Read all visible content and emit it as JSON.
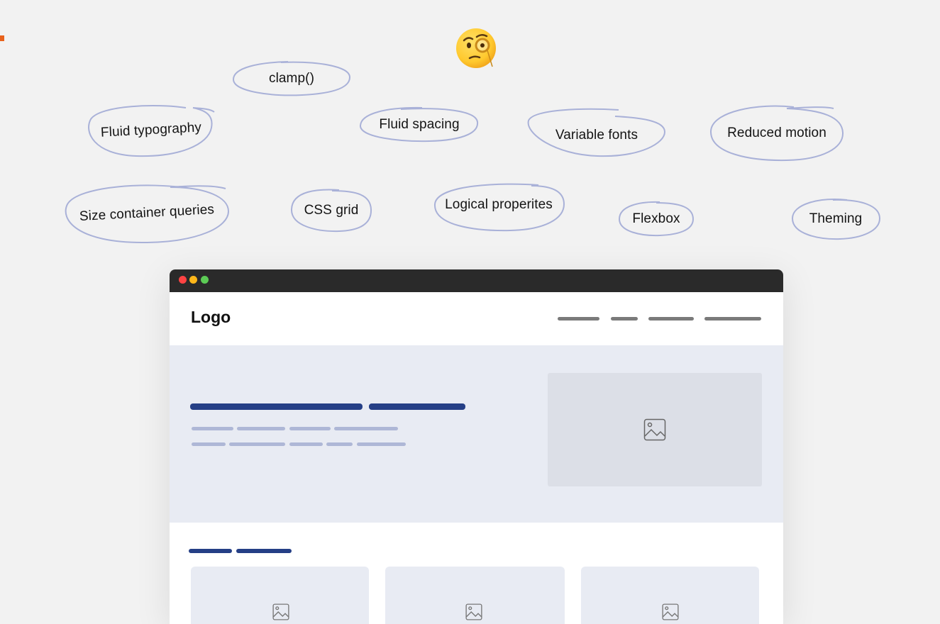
{
  "concepts": [
    "clamp()",
    "Fluid typography",
    "Fluid spacing",
    "Variable fonts",
    "Reduced motion",
    "Size container queries",
    "CSS grid",
    "Logical properites",
    "Flexbox",
    "Theming"
  ],
  "emoji": "face-with-monocle-icon",
  "browser": {
    "logo": "Logo"
  },
  "colors": {
    "background": "#f2f2f2",
    "outline": "#a9b1d8",
    "titlebar": "#2a2a2a",
    "hero": "#e8ebf3",
    "heading_bar": "#253f86",
    "text_bar": "#aeb7d6"
  }
}
